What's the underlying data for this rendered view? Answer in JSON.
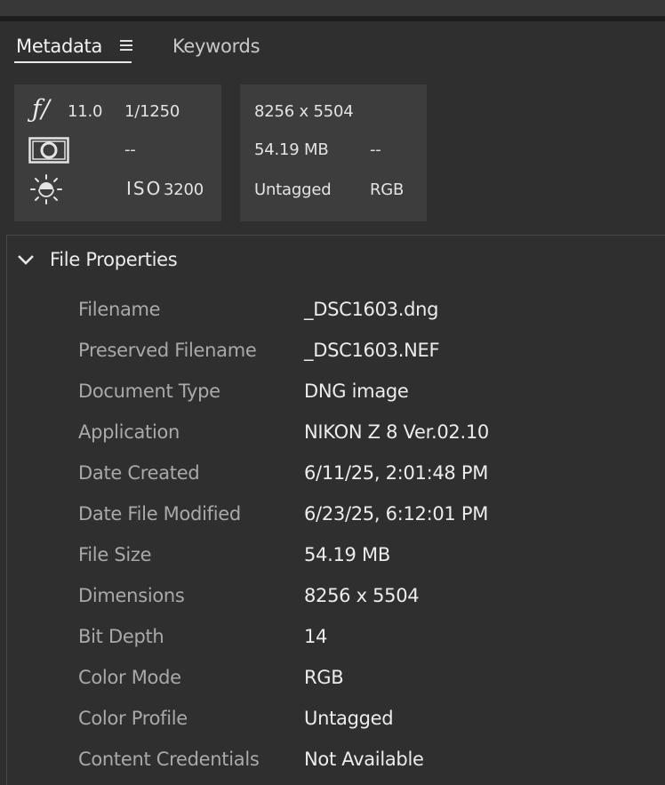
{
  "tabs": {
    "metadata": "Metadata",
    "keywords": "Keywords"
  },
  "quick_info": {
    "aperture": "11.0",
    "shutter": "1/1250",
    "metering": "--",
    "iso_label": "ISO",
    "iso": "3200",
    "dimensions": "8256 x 5504",
    "file_size": "54.19 MB",
    "extra": "--",
    "profile": "Untagged",
    "color_mode": "RGB"
  },
  "file_properties": {
    "title": "File Properties",
    "rows": [
      {
        "label": "Filename",
        "value": "_DSC1603.dng"
      },
      {
        "label": "Preserved Filename",
        "value": "_DSC1603.NEF"
      },
      {
        "label": "Document Type",
        "value": "DNG image"
      },
      {
        "label": "Application",
        "value": "NIKON Z 8 Ver.02.10"
      },
      {
        "label": "Date Created",
        "value": "6/11/25, 2:01:48 PM"
      },
      {
        "label": "Date File Modified",
        "value": "6/23/25, 6:12:01 PM"
      },
      {
        "label": "File Size",
        "value": "54.19 MB"
      },
      {
        "label": "Dimensions",
        "value": "8256 x 5504"
      },
      {
        "label": "Bit Depth",
        "value": "14"
      },
      {
        "label": "Color Mode",
        "value": "RGB"
      },
      {
        "label": "Color Profile",
        "value": "Untagged"
      },
      {
        "label": "Content Credentials",
        "value": "Not Available"
      }
    ]
  }
}
